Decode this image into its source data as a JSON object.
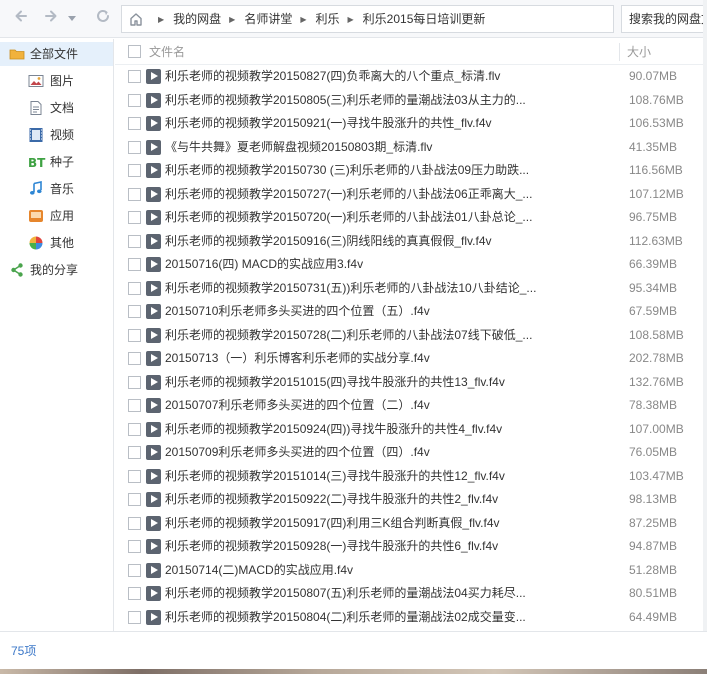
{
  "toolbar": {
    "back_icon": "arrow-left-icon",
    "forward_icon": "arrow-right-icon",
    "history_dropdown_icon": "chevron-down-icon",
    "refresh_icon": "refresh-icon"
  },
  "breadcrumb": {
    "home_icon": "home-icon",
    "items": [
      "我的网盘",
      "名师讲堂",
      "利乐",
      "利乐2015每日培训更新"
    ]
  },
  "search": {
    "placeholder": "搜索我的网盘文"
  },
  "sidebar": {
    "items": [
      {
        "label": "全部文件",
        "icon": "folder-icon",
        "active": true
      },
      {
        "label": "图片",
        "icon": "image-icon"
      },
      {
        "label": "文档",
        "icon": "document-icon"
      },
      {
        "label": "视频",
        "icon": "film-icon"
      },
      {
        "label": "种子",
        "icon": "bt-icon"
      },
      {
        "label": "音乐",
        "icon": "music-note-icon"
      },
      {
        "label": "应用",
        "icon": "app-icon"
      },
      {
        "label": "其他",
        "icon": "pie-icon"
      },
      {
        "label": "我的分享",
        "icon": "share-icon"
      }
    ]
  },
  "list": {
    "header": {
      "name": "文件名",
      "size": "大小"
    },
    "files": [
      {
        "name": "利乐老师的视频教学20150827(四)负乖离大的八个重点_标清.flv",
        "size": "90.07MB"
      },
      {
        "name": "利乐老师的视频教学20150805(三)利乐老师的量潮战法03从主力的...",
        "size": "108.76MB"
      },
      {
        "name": "利乐老师的视频教学20150921(一)寻找牛股涨升的共性_flv.f4v",
        "size": "106.53MB"
      },
      {
        "name": "《与牛共舞》夏老师解盘视频20150803期_标清.flv",
        "size": "41.35MB"
      },
      {
        "name": "利乐老师的视频教学20150730 (三)利乐老师的八卦战法09压力助跌...",
        "size": "116.56MB"
      },
      {
        "name": "利乐老师的视频教学20150727(一)利乐老师的八卦战法06正乖离大_...",
        "size": "107.12MB"
      },
      {
        "name": "利乐老师的视频教学20150720(一)利乐老师的八卦战法01八卦总论_...",
        "size": "96.75MB"
      },
      {
        "name": "利乐老师的视频教学20150916(三)阴线阳线的真真假假_flv.f4v",
        "size": "112.63MB"
      },
      {
        "name": "20150716(四) MACD的实战应用3.f4v",
        "size": "66.39MB"
      },
      {
        "name": "利乐老师的视频教学20150731(五))利乐老师的八卦战法10八卦结论_...",
        "size": "95.34MB"
      },
      {
        "name": "20150710利乐老师多头买进的四个位置（五）.f4v",
        "size": "67.59MB"
      },
      {
        "name": "利乐老师的视频教学20150728(二)利乐老师的八卦战法07线下破低_...",
        "size": "108.58MB"
      },
      {
        "name": "20150713（一）利乐博客利乐老师的实战分享.f4v",
        "size": "202.78MB"
      },
      {
        "name": "利乐老师的视频教学20151015(四)寻找牛股涨升的共性13_flv.f4v",
        "size": "132.76MB"
      },
      {
        "name": "20150707利乐老师多头买进的四个位置（二）.f4v",
        "size": "78.38MB"
      },
      {
        "name": "利乐老师的视频教学20150924(四))寻找牛股涨升的共性4_flv.f4v",
        "size": "107.00MB"
      },
      {
        "name": "20150709利乐老师多头买进的四个位置（四）.f4v",
        "size": "76.05MB"
      },
      {
        "name": "利乐老师的视频教学20151014(三)寻找牛股涨升的共性12_flv.f4v",
        "size": "103.47MB"
      },
      {
        "name": "利乐老师的视频教学20150922(二)寻找牛股涨升的共性2_flv.f4v",
        "size": "98.13MB"
      },
      {
        "name": "利乐老师的视频教学20150917(四)利用三K组合判断真假_flv.f4v",
        "size": "87.25MB"
      },
      {
        "name": "利乐老师的视频教学20150928(一)寻找牛股涨升的共性6_flv.f4v",
        "size": "94.87MB"
      },
      {
        "name": "20150714(二)MACD的实战应用.f4v",
        "size": "51.28MB"
      },
      {
        "name": "利乐老师的视频教学20150807(五)利乐老师的量潮战法04买力耗尽...",
        "size": "80.51MB"
      },
      {
        "name": "利乐老师的视频教学20150804(二)利乐老师的量潮战法02成交量变...",
        "size": "64.49MB"
      }
    ],
    "file_icon": "video-file-icon"
  },
  "status": {
    "count": "75项"
  },
  "colors": {
    "accent": "#3c78c8",
    "active_bg": "#e5f0fb"
  }
}
